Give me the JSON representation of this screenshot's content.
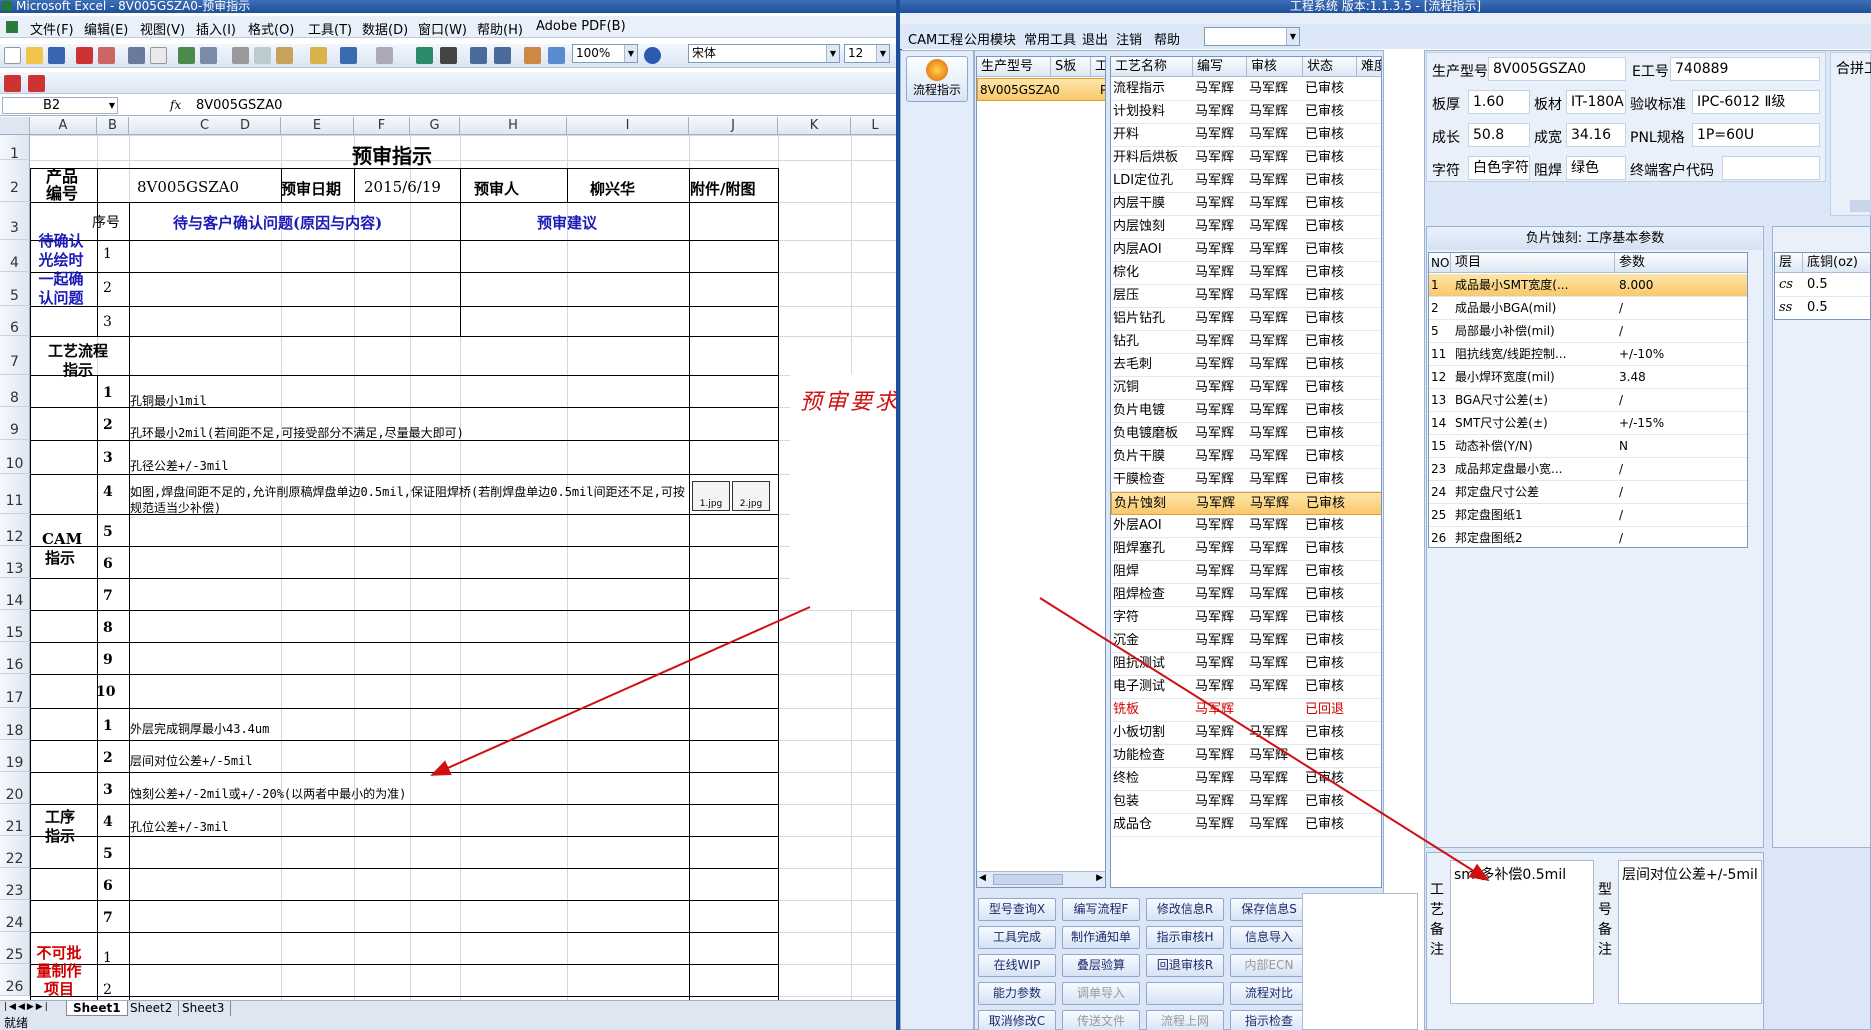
{
  "excel": {
    "title": "Microsoft Excel - 8V005GSZA0-预审指示",
    "menu": [
      "文件(F)",
      "编辑(E)",
      "视图(V)",
      "插入(I)",
      "格式(O)",
      "工具(T)",
      "数据(D)",
      "窗口(W)",
      "帮助(H)",
      "Adobe PDF(B)"
    ],
    "zoom": "100%",
    "font": "宋体",
    "size": "12",
    "namebox": "B2",
    "fx": "fx",
    "formula": "8V005GSZA0",
    "columns": [
      "A",
      "B",
      "C",
      "D",
      "E",
      "F",
      "G",
      "H",
      "I",
      "J",
      "K",
      "L"
    ],
    "rows": [
      "1",
      "2",
      "3",
      "4",
      "5",
      "6",
      "7",
      "8",
      "9",
      "10",
      "11",
      "12",
      "13",
      "14",
      "15",
      "16",
      "17",
      "18",
      "19",
      "20",
      "21",
      "22",
      "23",
      "24",
      "25",
      "26"
    ],
    "sheet": {
      "title": "预审指示",
      "product_label": "产品编号",
      "product_value": "8V005GSZA0",
      "date_label": "预审日期",
      "date_value": "2015/6/19",
      "reviewer_label": "预审人",
      "reviewer_value": "柳兴华",
      "attach_label": "附件/附图",
      "confirm_label": "待确认光绘时一起确认问题",
      "seq_label": "序号",
      "question_label": "待与客户确认问题(原因与内容)",
      "suggest_label": "预审建议",
      "confirm_nums": [
        "1",
        "2",
        "3"
      ],
      "flow_label": "工艺流程指示",
      "cam_label": "CAM指示",
      "cam_nums": [
        "1",
        "2",
        "3",
        "4",
        "5",
        "6",
        "7",
        "8",
        "9",
        "10"
      ],
      "cam_items": [
        "孔铜最小1mil",
        "孔环最小2mil(若间距不足,可接受部分不满足,尽量最大即可)",
        "孔径公差+/-3mil",
        "如图,焊盘间距不足的,允许削原稿焊盘单边0.5mil,保证阻焊桥(若削焊盘单边0.5mil间距还不足,可按规范适当少补偿)"
      ],
      "attach_imgs": [
        "1.jpg",
        "2.jpg"
      ],
      "proc_label": "工序指示",
      "proc_nums": [
        "1",
        "2",
        "3",
        "4",
        "5",
        "6",
        "7"
      ],
      "proc_items": [
        "外层完成铜厚最小43.4um",
        "层间对位公差+/-5mil",
        "蚀刻公差+/-2mil或+/-20%(以两者中最小的为准)",
        "孔位公差+/-3mil"
      ],
      "nobatch_label": "不可批量制作项目",
      "nobatch_nums": [
        "1",
        "2"
      ]
    },
    "tabs": [
      "Sheet1",
      "Sheet2",
      "Sheet3"
    ],
    "status": "就绪"
  },
  "annotation": {
    "text": "预审要求漏备注",
    "color": "#d01010"
  },
  "app": {
    "title": "工程系统  版本:1.1.3.5 - [流程指示]",
    "menu": [
      "CAM工程",
      "公用模块",
      "常用工具",
      "退出",
      "注销",
      "帮助"
    ],
    "side_btn": "流程指示",
    "model_cols": [
      "生产型号",
      "S板",
      "工"
    ],
    "model_row": [
      "8V005GSZA0",
      "P"
    ],
    "proc_cols": [
      "工艺名称",
      "编写",
      "审核",
      "状态",
      "难度"
    ],
    "processes": [
      [
        "流程指示",
        "马军辉",
        "马军辉",
        "已审核"
      ],
      [
        "计划投料",
        "马军辉",
        "马军辉",
        "已审核"
      ],
      [
        "开料",
        "马军辉",
        "马军辉",
        "已审核"
      ],
      [
        "开料后烘板",
        "马军辉",
        "马军辉",
        "已审核"
      ],
      [
        "LDI定位孔",
        "马军辉",
        "马军辉",
        "已审核"
      ],
      [
        "内层干膜",
        "马军辉",
        "马军辉",
        "已审核"
      ],
      [
        "内层蚀刻",
        "马军辉",
        "马军辉",
        "已审核"
      ],
      [
        "内层AOI",
        "马军辉",
        "马军辉",
        "已审核"
      ],
      [
        "棕化",
        "马军辉",
        "马军辉",
        "已审核"
      ],
      [
        "层压",
        "马军辉",
        "马军辉",
        "已审核"
      ],
      [
        "铝片钻孔",
        "马军辉",
        "马军辉",
        "已审核"
      ],
      [
        "钻孔",
        "马军辉",
        "马军辉",
        "已审核"
      ],
      [
        "去毛刺",
        "马军辉",
        "马军辉",
        "已审核"
      ],
      [
        "沉铜",
        "马军辉",
        "马军辉",
        "已审核"
      ],
      [
        "负片电镀",
        "马军辉",
        "马军辉",
        "已审核"
      ],
      [
        "负电镀磨板",
        "马军辉",
        "马军辉",
        "已审核"
      ],
      [
        "负片干膜",
        "马军辉",
        "马军辉",
        "已审核"
      ],
      [
        "干膜检查",
        "马军辉",
        "马军辉",
        "已审核"
      ],
      [
        "负片蚀刻",
        "马军辉",
        "马军辉",
        "已审核"
      ],
      [
        "外层AOI",
        "马军辉",
        "马军辉",
        "已审核"
      ],
      [
        "阻焊塞孔",
        "马军辉",
        "马军辉",
        "已审核"
      ],
      [
        "阻焊",
        "马军辉",
        "马军辉",
        "已审核"
      ],
      [
        "阻焊检查",
        "马军辉",
        "马军辉",
        "已审核"
      ],
      [
        "字符",
        "马军辉",
        "马军辉",
        "已审核"
      ],
      [
        "沉金",
        "马军辉",
        "马军辉",
        "已审核"
      ],
      [
        "阻抗测试",
        "马军辉",
        "马军辉",
        "已审核"
      ],
      [
        "电子测试",
        "马军辉",
        "马军辉",
        "已审核"
      ],
      [
        "铣板",
        "马军辉",
        "",
        "已回退"
      ],
      [
        "小板切割",
        "马军辉",
        "马军辉",
        "已审核"
      ],
      [
        "功能检查",
        "马军辉",
        "马军辉",
        "已审核"
      ],
      [
        "终检",
        "马军辉",
        "马军辉",
        "已审核"
      ],
      [
        "包装",
        "马军辉",
        "马军辉",
        "已审核"
      ],
      [
        "成品仓",
        "马军辉",
        "马军辉",
        "已审核"
      ]
    ],
    "selected_index": 18,
    "returned_index": 27,
    "info": {
      "model_label": "生产型号",
      "model": "8V005GSZA0",
      "eng_label": "E工号",
      "eng": "740889",
      "extra": "合拼工",
      "thick_label": "板厚",
      "thick": "1.60",
      "mat_label": "板材",
      "mat": "IT-180A",
      "std_label": "验收标准",
      "std": "IPC-6012 Ⅱ级",
      "len_label": "成长",
      "len": "50.8",
      "wid_label": "成宽",
      "wid": "34.16",
      "pnl_label": "PNL规格",
      "pnl": "1P=60U",
      "char_label": "字符",
      "char": "白色字符",
      "mask_label": "阻焊",
      "mask": "绿色",
      "cust_label": "终端客户代码"
    },
    "param_title": "负片蚀刻: 工序基本参数",
    "param_cols": [
      "NO",
      "项目",
      "参数"
    ],
    "params": [
      [
        "1",
        "成品最小SMT宽度(...",
        "8.000"
      ],
      [
        "2",
        "成品最小BGA(mil)",
        "/"
      ],
      [
        "5",
        "局部最小补偿(mil)",
        "/"
      ],
      [
        "11",
        "阻抗线宽/线距控制...",
        "+/-10%"
      ],
      [
        "12",
        "最小焊环宽度(mil)",
        "3.48"
      ],
      [
        "13",
        "BGA尺寸公差(±)",
        "/"
      ],
      [
        "14",
        "SMT尺寸公差(±)",
        "+/-15%"
      ],
      [
        "15",
        "动态补偿(Y/N)",
        "N"
      ],
      [
        "23",
        "成品邦定盘最小宽...",
        "/"
      ],
      [
        "24",
        "邦定盘尺寸公差",
        "/"
      ],
      [
        "25",
        "邦定盘图纸1",
        "/"
      ],
      [
        "26",
        "邦定盘图纸2",
        "/"
      ]
    ],
    "cu_cols": [
      "层",
      "底铜(oz)"
    ],
    "cu_rows": [
      [
        "cs",
        "0.5"
      ],
      [
        "ss",
        "0.5"
      ]
    ],
    "buttons": [
      [
        "型号查询X",
        "编写流程F",
        "修改信息R",
        "保存信息S"
      ],
      [
        "工具完成",
        "制作通知单",
        "指示审核H",
        "信息导入"
      ],
      [
        "在线WIP",
        "叠层验算",
        "回退审核R",
        "内部ECN"
      ],
      [
        "能力参数",
        "调单导入",
        "",
        "流程对比"
      ],
      [
        "取消修改C",
        "传送文件",
        "流程上网",
        "指示检查"
      ]
    ],
    "disabled_buttons": [
      "内部ECN",
      "调单导入",
      "传送文件",
      "流程上网"
    ],
    "craft_label": "工艺备注",
    "craft_note": "smt多补偿0.5mil",
    "model_note_label": "型号备注",
    "model_note": "层间对位公差+/-5mil"
  }
}
